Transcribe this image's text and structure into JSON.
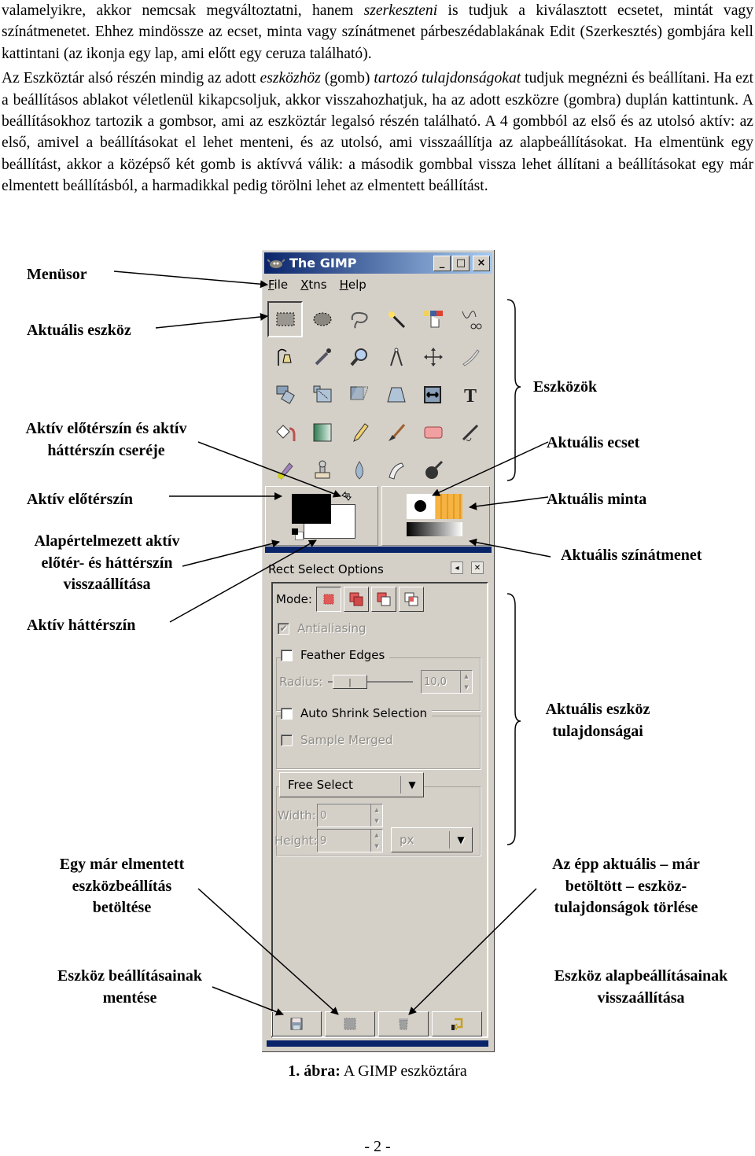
{
  "paragraphs": [
    {
      "parts": [
        {
          "t": "valamelyikre, akkor nemcsak megváltoztatni, hanem "
        },
        {
          "t": "szerkeszteni",
          "i": true
        },
        {
          "t": " is tudjuk a kiválasztott ecsetet, mintát vagy színátmenetet. Ehhez mindössze az ecset, minta vagy színátmenet párbeszédablakának Edit (Szerkesztés) gombjára kell kattintani (az ikonja egy lap, ami előtt egy ceruza található)."
        }
      ]
    },
    {
      "parts": [
        {
          "t": "Az Eszköztár alsó részén mindig az adott "
        },
        {
          "t": "eszközhöz",
          "i": true
        },
        {
          "t": " (gomb) "
        },
        {
          "t": "tartozó tulajdonságokat",
          "i": true
        },
        {
          "t": " tudjuk megnézni és beállítani. Ha ezt a beállításos ablakot véletlenül kikapcsoljuk, akkor visszahozhatjuk, ha az adott eszközre (gombra) duplán kattintunk. A beállításokhoz tartozik a gombsor, ami az eszköztár legalsó részén található. A 4 gombból az első és az utolsó aktív: az első, amivel a beállításokat el lehet menteni, és az utolsó, ami visszaállítja az alapbeállításokat. Ha elmentünk egy beállítást, akkor a középső két gomb is aktívvá válik: a második gombbal vissza lehet állítani a beállításokat egy már elmentett beállításból, a harmadikkal pedig törölni lehet az elmentett beállítást."
        }
      ]
    }
  ],
  "labels": {
    "menusor": "Menüsor",
    "aktualis_eszkoz": "Aktuális eszköz",
    "csere": [
      "Aktív előtérszín és aktív",
      "háttérszín cseréje"
    ],
    "eloterszin": "Aktív előtérszín",
    "alapertelmezett": [
      "Alapértelmezett aktív",
      "előtér- és háttérszín",
      "visszaállítása"
    ],
    "hatterszin": "Aktív háttérszín",
    "eszkozok": "Eszközök",
    "ecset": "Aktuális ecset",
    "minta": "Aktuális minta",
    "szinatmenet": "Aktuális színátmenet",
    "tulajdonsagai": [
      "Aktuális eszköz",
      "tulajdonságai"
    ],
    "betoltese": [
      "Egy már elmentett",
      "eszközbeállítás",
      "betöltése"
    ],
    "mentese": [
      "Eszköz beállításainak",
      "mentése"
    ],
    "torlese": [
      "Az épp aktuális – már",
      "betöltött – eszköz-",
      "tulajdonságok  törlése"
    ],
    "visszaallitasa": [
      "Eszköz alapbeállításainak",
      "visszaállítása"
    ]
  },
  "caption": {
    "bold": "1. ábra:",
    "rest": " A GIMP eszköztára"
  },
  "page_number": "- 2 -",
  "gimp": {
    "title": "The GIMP",
    "title_buttons": [
      "_",
      "□",
      "×"
    ],
    "menu": [
      {
        "mnemonic": "F",
        "rest": "ile"
      },
      {
        "mnemonic": "X",
        "rest": "tns"
      },
      {
        "mnemonic": "H",
        "rest": "elp"
      }
    ],
    "tools": [
      "rect-select",
      "ellipse-select",
      "free-select",
      "fuzzy-select",
      "color-select",
      "scissors",
      "paths",
      "color-picker",
      "zoom",
      "measure",
      "move",
      "crop",
      "transform",
      "scale",
      "shear",
      "perspective",
      "flip",
      "text",
      "bucket-fill",
      "blend",
      "pencil",
      "paintbrush",
      "eraser",
      "airbrush",
      "ink",
      "clone",
      "blur",
      "smudge",
      "dodge-burn"
    ],
    "active_tool": "rect-select",
    "fg_color": "#000000",
    "bg_color": "#ffffff",
    "pattern_color": "#f5b342",
    "options": {
      "title": "Rect Select Options",
      "mode_label": "Mode:",
      "antialiasing": {
        "label": "Antialiasing",
        "checked": true,
        "enabled": false
      },
      "feather_edges": {
        "label": "Feather Edges",
        "checked": false
      },
      "radius_label": "Radius:",
      "radius_value": "10,0",
      "auto_shrink": {
        "label": "Auto Shrink Selection",
        "checked": false
      },
      "sample_merged": {
        "label": "Sample Merged",
        "checked": false,
        "enabled": false
      },
      "fixed_mode": "Free Select",
      "width_label": "Width:",
      "width_value": "0",
      "height_label": "Height:",
      "height_value": "9",
      "unit": "px"
    },
    "bottom_buttons": [
      "save-options",
      "restore-options",
      "delete-options",
      "reset-options"
    ]
  }
}
